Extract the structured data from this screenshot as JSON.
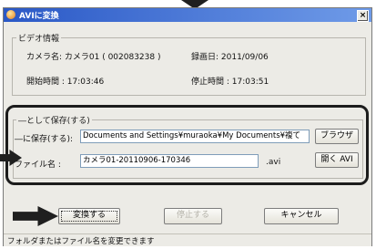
{
  "window": {
    "title": "AVIに変換",
    "close_glyph": "×"
  },
  "video_info": {
    "legend": "ビデオ情報",
    "camera_name": "カメラ名: カメラ01 ( 002083238 )",
    "record_date": "録画日: 2011/09/06",
    "start_time": "開始時間 : 17:03:46",
    "stop_time": "停止時間 : 17:03:51"
  },
  "save_group": {
    "legend": "―として保存(する)",
    "save_to_label": "―に保存(する):",
    "save_to_value": "Documents and Settings¥muraoka¥My Documents¥複て",
    "browse_button": "ブラウザ",
    "filename_label": "ファイル名 :",
    "filename_value": "カメラ01-20110906-170346",
    "extension": ".avi",
    "open_avi_button": "開く AVI"
  },
  "actions": {
    "convert_button": "変換する",
    "stop_button": "停止する",
    "cancel_button": "キャンセル"
  },
  "status": {
    "text": "フォルダまたはファイル名を変更できます"
  },
  "colors": {
    "titlebar": "#2a58c6",
    "window_bg": "#ecebe6",
    "callout": "#1c1c1c"
  },
  "icons": {
    "title_icon": "app-icon",
    "callout_arrows": "arrow-icon"
  }
}
